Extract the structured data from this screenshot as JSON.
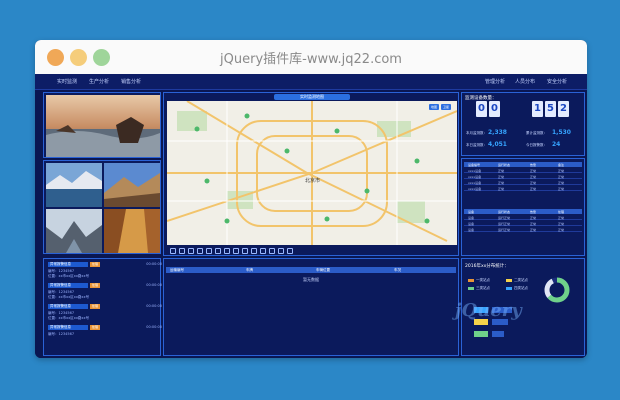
{
  "window": {
    "title": "jQuery插件库-www.jq22.com"
  },
  "nav_left": [
    "实时监测",
    "生产分析",
    "销售分析"
  ],
  "nav_right": [
    "管理分析",
    "人员分布",
    "安全分析"
  ],
  "map": {
    "badge": "实时监测地图",
    "city_label": "北京市",
    "controls": [
      "地图",
      "卫星"
    ]
  },
  "left_list": {
    "rows": [
      {
        "tag": "异常报警信息",
        "status": "处理",
        "time": "00:00:00",
        "line1": "编号：1234567",
        "line2": "位置：xx市xx区xx路xx号"
      },
      {
        "tag": "异常报警信息",
        "status": "处理",
        "time": "00:00:00",
        "line1": "编号：1234567",
        "line2": "位置：xx市xx区xx路xx号"
      },
      {
        "tag": "异常报警信息",
        "status": "处理",
        "time": "00:00:00",
        "line1": "编号：1234567",
        "line2": "位置：xx市xx区xx路xx号"
      },
      {
        "tag": "异常报警信息",
        "status": "处理",
        "time": "00:00:00",
        "line1": "编号：1234567",
        "line2": ""
      }
    ]
  },
  "center_table": {
    "headers": [
      "运输编号",
      "车牌",
      "车辆位置",
      "车况"
    ],
    "empty_text": "暂无数据"
  },
  "monitor": {
    "title": "监测设备数量：",
    "digits_left": [
      "0",
      "0"
    ],
    "digits_right": [
      "1",
      "5",
      "2"
    ],
    "stats": [
      {
        "label": "本月监测数：",
        "value": "2,338"
      },
      {
        "label": "累计监测数：",
        "value": "1,530"
      },
      {
        "label": "本日监测数：",
        "value": "4,051"
      },
      {
        "label": "今日报警数：",
        "value": "24"
      }
    ]
  },
  "status_table": {
    "headers": [
      "设备编号",
      "运行状态",
      "告警",
      "备注"
    ],
    "rows": [
      [
        "xxxx设备",
        "正常",
        "正常",
        "正常"
      ],
      [
        "xxxx设备",
        "正常",
        "正常",
        "正常"
      ],
      [
        "xxxx设备",
        "正常",
        "正常",
        "正常"
      ],
      [
        "xxxx设备",
        "正常",
        "正常",
        "正常"
      ]
    ]
  },
  "status_table2": {
    "headers": [
      "设备",
      "运行状态",
      "告警",
      "处理"
    ],
    "rows": [
      [
        "设备",
        "运行正常",
        "正常",
        "正常"
      ],
      [
        "设备",
        "运行正常",
        "正常",
        "正常"
      ],
      [
        "设备",
        "运行正常",
        "正常",
        "正常"
      ]
    ]
  },
  "dist": {
    "title": "2016年xx分布统计：",
    "legend": [
      {
        "label": "一类站点",
        "color": "#e89438"
      },
      {
        "label": "二类站点",
        "color": "#f5d24a"
      },
      {
        "label": "三类站点",
        "color": "#6fd18a"
      },
      {
        "label": "四类站点",
        "color": "#36a4ff"
      }
    ]
  },
  "watermark": "jQuery"
}
